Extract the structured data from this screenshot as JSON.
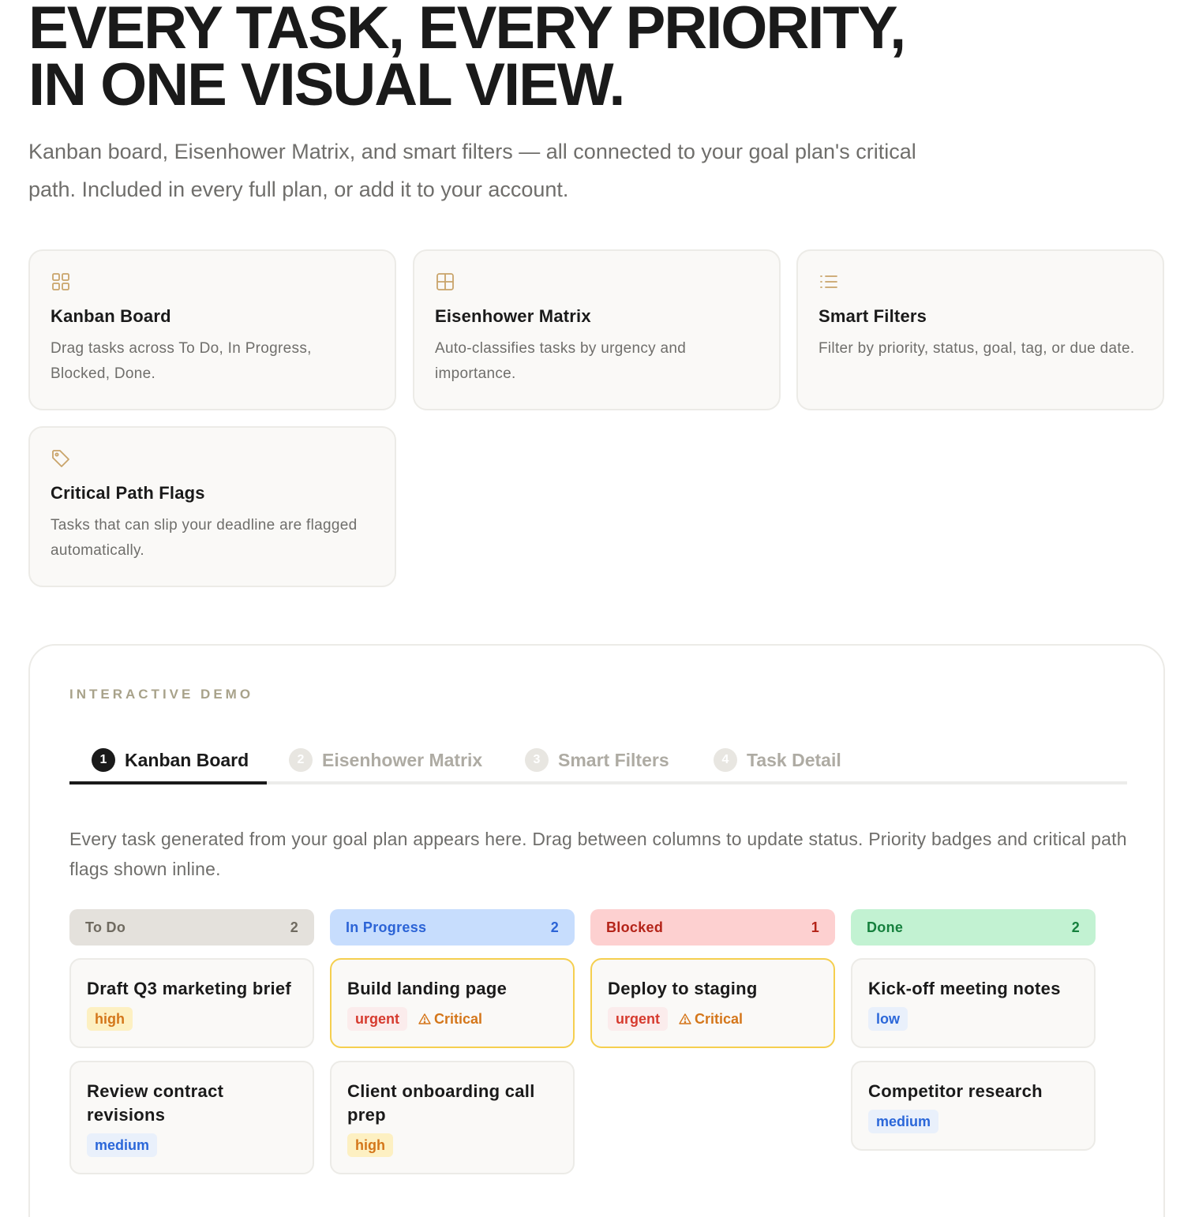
{
  "hero": {
    "title_line1": "EVERY TASK, EVERY PRIORITY,",
    "title_line2": "IN ONE VISUAL VIEW.",
    "subtitle": "Kanban board, Eisenhower Matrix, and smart filters — all connected to your goal plan's critical path. Included in every full plan, or add it to your account."
  },
  "features": [
    {
      "title": "Kanban Board",
      "desc": "Drag tasks across To Do, In Progress, Blocked, Done.",
      "icon": "grid-icon"
    },
    {
      "title": "Eisenhower Matrix",
      "desc": "Auto-classifies tasks by urgency and importance.",
      "icon": "matrix-icon"
    },
    {
      "title": "Smart Filters",
      "desc": "Filter by priority, status, goal, tag, or due date.",
      "icon": "list-icon"
    },
    {
      "title": "Critical Path Flags",
      "desc": "Tasks that can slip your deadline are flagged automatically.",
      "icon": "tag-icon"
    }
  ],
  "demo": {
    "eyebrow": "INTERACTIVE DEMO",
    "tabs": [
      {
        "num": "1",
        "label": "Kanban Board"
      },
      {
        "num": "2",
        "label": "Eisenhower Matrix"
      },
      {
        "num": "3",
        "label": "Smart Filters"
      },
      {
        "num": "4",
        "label": "Task Detail"
      }
    ],
    "active_tab": "Kanban Board",
    "description": "Every task generated from your goal plan appears here. Drag between columns to update status. Priority badges and critical path flags shown inline.",
    "columns": [
      {
        "name": "To Do",
        "count": "2",
        "bg": "#e4e1dc",
        "color": "#6f6a60",
        "tasks": [
          {
            "title": "Draft Q3 marketing brief",
            "priority": "high"
          },
          {
            "title": "Review contract revisions",
            "priority": "medium"
          }
        ]
      },
      {
        "name": "In Progress",
        "count": "2",
        "bg": "#c7ddfd",
        "color": "#2b63d6",
        "tasks": [
          {
            "title": "Build landing page",
            "priority": "urgent",
            "flag": "Critical"
          },
          {
            "title": "Client onboarding call prep",
            "priority": "high"
          }
        ]
      },
      {
        "name": "Blocked",
        "count": "1",
        "bg": "#fdd0d0",
        "color": "#b42318",
        "tasks": [
          {
            "title": "Deploy to staging",
            "priority": "urgent",
            "flag": "Critical"
          }
        ]
      },
      {
        "name": "Done",
        "count": "2",
        "bg": "#c2f2d2",
        "color": "#15803d",
        "tasks": [
          {
            "title": "Kick-off meeting notes",
            "priority": "low"
          },
          {
            "title": "Competitor research",
            "priority": "medium"
          }
        ]
      }
    ],
    "flag_icon": "warning-icon"
  },
  "colors": {
    "accent_icon": "#c9a46a",
    "critical_border": "#f5cf4f"
  }
}
